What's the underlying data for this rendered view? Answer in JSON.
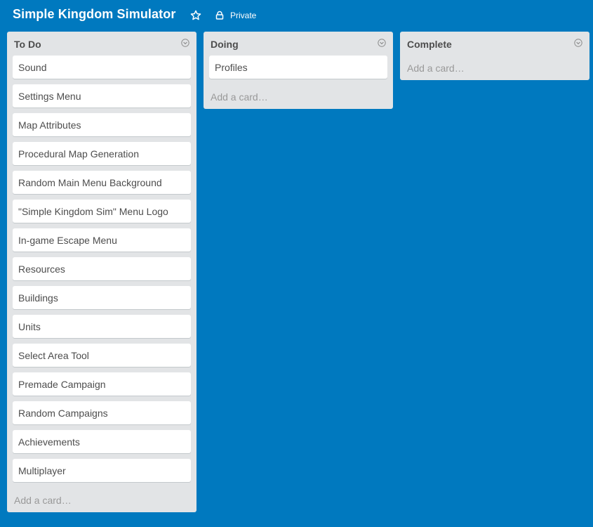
{
  "board": {
    "title": "Simple Kingdom Simulator",
    "privacy_label": "Private",
    "background_color": "#0079bf",
    "star_icon": "star-icon",
    "privacy_icon": "lock-icon"
  },
  "lists": [
    {
      "title": "To Do",
      "cards": [
        "Sound",
        "Settings Menu",
        "Map Attributes",
        "Procedural Map Generation",
        "Random Main Menu Background",
        "\"Simple Kingdom Sim\" Menu Logo",
        "In-game Escape Menu",
        "Resources",
        "Buildings",
        "Units",
        "Select Area Tool",
        "Premade Campaign",
        "Random Campaigns",
        "Achievements",
        "Multiplayer"
      ],
      "add_card_label": "Add a card…"
    },
    {
      "title": "Doing",
      "cards": [
        "Profiles"
      ],
      "add_card_label": "Add a card…"
    },
    {
      "title": "Complete",
      "cards": [],
      "add_card_label": "Add a card…"
    }
  ],
  "list_menu_icon": "chevron-down-circle-icon"
}
